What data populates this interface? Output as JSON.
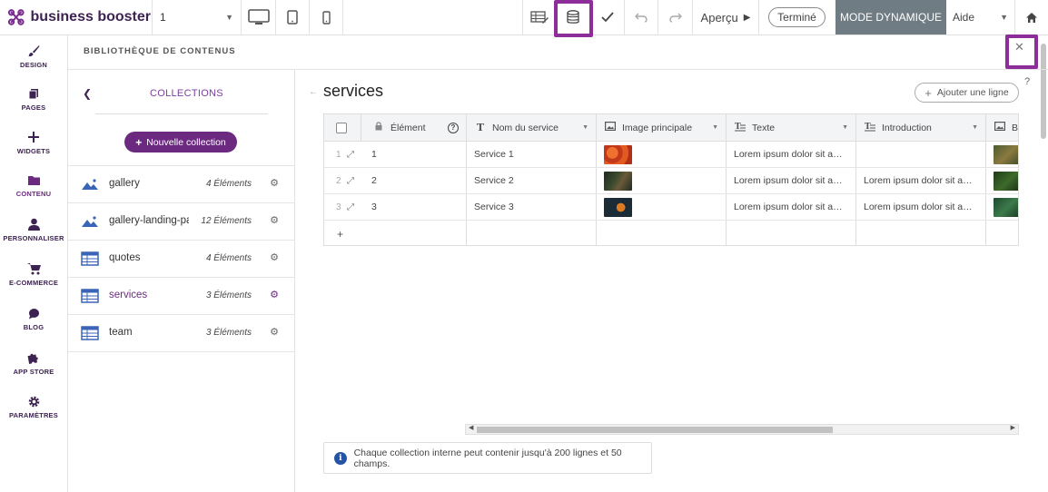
{
  "topbar": {
    "brand": "business booster",
    "page_select": "1",
    "apercu": "Aperçu",
    "termine": "Terminé",
    "mode": "MODE DYNAMIQUE",
    "aide": "Aide"
  },
  "leftnav": [
    {
      "label": "DESIGN",
      "icon": "brush-icon"
    },
    {
      "label": "PAGES",
      "icon": "pages-icon"
    },
    {
      "label": "WIDGETS",
      "icon": "plus-icon"
    },
    {
      "label": "CONTENU",
      "icon": "folder-icon"
    },
    {
      "label": "PERSONNALISER",
      "icon": "user-icon"
    },
    {
      "label": "E-COMMERCE",
      "icon": "cart-icon"
    },
    {
      "label": "BLOG",
      "icon": "comment-icon"
    },
    {
      "label": "APP STORE",
      "icon": "puzzle-icon"
    },
    {
      "label": "PARAMÈTRES",
      "icon": "gear-icon"
    }
  ],
  "library": {
    "title": "BIBLIOTHÈQUE DE CONTENUS"
  },
  "collections": {
    "title": "COLLECTIONS",
    "new_button": "Nouvelle collection",
    "items": [
      {
        "name": "gallery",
        "count": "4 Éléments",
        "type": "gallery",
        "active": false
      },
      {
        "name": "gallery-landing-page",
        "count": "12 Éléments",
        "type": "gallery",
        "active": false
      },
      {
        "name": "quotes",
        "count": "4 Éléments",
        "type": "table",
        "active": false
      },
      {
        "name": "services",
        "count": "3 Éléments",
        "type": "table",
        "active": true
      },
      {
        "name": "team",
        "count": "3 Éléments",
        "type": "table",
        "active": false
      }
    ]
  },
  "main": {
    "title": "services",
    "add_row": "Ajouter une ligne",
    "help": "?",
    "columns": [
      {
        "label": "Élément",
        "icon": "lock-icon"
      },
      {
        "label": "Nom du service",
        "icon": "text-icon"
      },
      {
        "label": "Image principale",
        "icon": "image-icon"
      },
      {
        "label": "Texte",
        "icon": "paragraph-icon"
      },
      {
        "label": "Introduction",
        "icon": "paragraph-icon"
      },
      {
        "label": "Ba",
        "icon": "image-icon"
      }
    ],
    "rows": [
      {
        "num": "1",
        "element": "1",
        "name": "Service 1",
        "texte": "Lorem ipsum dolor sit amet",
        "intro": "",
        "img": "#d2451c",
        "img2": "#5b6b3a"
      },
      {
        "num": "2",
        "element": "2",
        "name": "Service 2",
        "texte": "Lorem ipsum dolor sit amet",
        "intro": "Lorem ipsum dolor sit amet",
        "img": "#2f3a2a",
        "img2": "#2c4a24"
      },
      {
        "num": "3",
        "element": "3",
        "name": "Service 3",
        "texte": "Lorem ipsum dolor sit amet",
        "intro": "Lorem ipsum dolor sit amet",
        "img": "#1f2e38",
        "img2": "#2d5a3a"
      }
    ],
    "info": "Chaque collection interne peut contenir jusqu'à 200 lignes et 50 champs."
  },
  "colors": {
    "brand": "#3d2352",
    "accent": "#6b2a7f",
    "highlight": "#8c2d9a",
    "mode_bg": "#6f7c84"
  }
}
